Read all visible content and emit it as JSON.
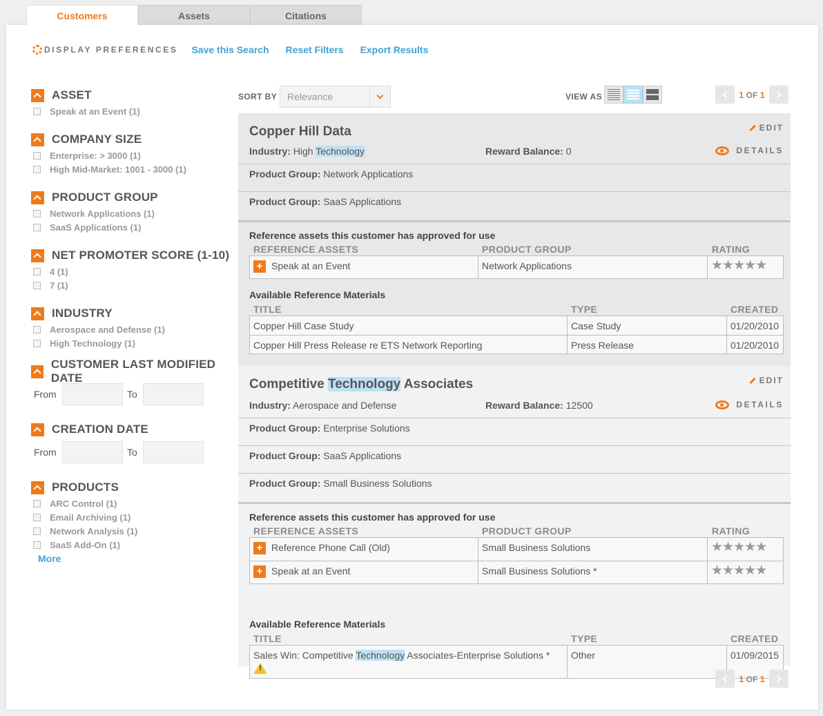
{
  "tabs": [
    "Customers",
    "Assets",
    "Citations"
  ],
  "actions": {
    "display_prefs": "DISPLAY PREFERENCES",
    "save_search": "Save this Search",
    "reset_filters": "Reset Filters",
    "export_results": "Export Results"
  },
  "filters": {
    "asset": {
      "title": "ASSET",
      "options": [
        "Speak at an Event (1)"
      ]
    },
    "company_size": {
      "title": "COMPANY SIZE",
      "options": [
        "Enterprise: > 3000 (1)",
        "High Mid-Market: 1001 - 3000 (1)"
      ]
    },
    "product_group": {
      "title": "PRODUCT GROUP",
      "options": [
        "Network Applications (1)",
        "SaaS Applications (1)"
      ]
    },
    "nps": {
      "title": "NET PROMOTER SCORE (1-10)",
      "options": [
        "4 (1)",
        "7 (1)"
      ]
    },
    "industry": {
      "title": "INDUSTRY",
      "options": [
        "Aerospace and Defense (1)",
        "High Technology (1)"
      ]
    },
    "last_modified": {
      "title": "CUSTOMER LAST MODIFIED DATE",
      "from": "From",
      "to": "To"
    },
    "creation_date": {
      "title": "CREATION DATE",
      "from": "From",
      "to": "To"
    },
    "products": {
      "title": "PRODUCTS",
      "options": [
        "ARC Control (1)",
        "Email Archiving (1)",
        "Network Analysis (1)",
        "SaaS Add-On (1)"
      ],
      "more": "More"
    }
  },
  "toolbar": {
    "sort_by": "SORT BY",
    "sort_value": "Relevance",
    "view_as": "VIEW AS",
    "page_current": "1",
    "page_of": "OF",
    "page_total": "1"
  },
  "labels": {
    "edit": "EDIT",
    "details": "DETAILS",
    "industry": "Industry:",
    "reward": "Reward Balance:",
    "product_group": "Product Group:",
    "approved": "Reference assets this customer has approved for use",
    "col_assets": "REFERENCE ASSETS",
    "col_group": "PRODUCT GROUP",
    "col_rating": "RATING",
    "materials": "Available Reference Materials",
    "col_title": "TITLE",
    "col_type": "TYPE",
    "col_created": "CREATED",
    "stars": "★★★★★"
  },
  "customers": [
    {
      "name": "Copper Hill Data",
      "industry_pre": "High ",
      "industry_hl": "Technology",
      "reward": "0",
      "product_groups": [
        "Network Applications",
        "SaaS Applications"
      ],
      "assets": [
        {
          "name": "Speak at an Event",
          "group": "Network Applications"
        }
      ],
      "materials": [
        {
          "title": "Copper Hill Case Study",
          "type": "Case Study",
          "created": "01/20/2010"
        },
        {
          "title": "Copper Hill Press Release re ETS Network Reporting",
          "type": "Press Release",
          "created": "01/20/2010"
        }
      ]
    },
    {
      "name_pre": "Competitive ",
      "name_hl": "Technology",
      "name_post": " Associates",
      "industry": "Aerospace and Defense",
      "reward": "12500",
      "product_groups": [
        "Enterprise Solutions",
        "SaaS Applications",
        "Small Business Solutions"
      ],
      "assets": [
        {
          "name": "Reference Phone Call (Old)",
          "group": "Small Business Solutions"
        },
        {
          "name": "Speak at an Event",
          "group": "Small Business Solutions *"
        }
      ],
      "materials": [
        {
          "title_pre": "Sales Win: Competitive ",
          "title_hl": "Technology",
          "title_post": " Associates-Enterprise Solutions *",
          "type": "Other",
          "created": "01/09/2015"
        }
      ]
    }
  ]
}
